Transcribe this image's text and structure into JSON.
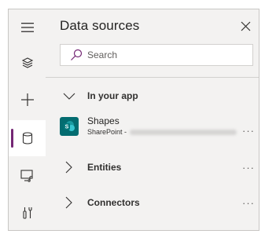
{
  "panel": {
    "title": "Data sources"
  },
  "search": {
    "placeholder": "Search"
  },
  "sections": {
    "in_your_app": "In your app",
    "entities": "Entities",
    "connectors": "Connectors"
  },
  "source": {
    "name": "Shapes",
    "subtitle": "SharePoint -",
    "icon_letter": "S"
  },
  "more_glyph": "···",
  "rail": {
    "items": [
      "menu-icon",
      "layers-icon",
      "add-icon",
      "database-icon",
      "media-icon",
      "tools-icon"
    ],
    "active_item": "database-icon"
  },
  "colors": {
    "accent": "#742774",
    "sharepoint": "#036c70",
    "panel_bg": "#f3f2f1"
  }
}
